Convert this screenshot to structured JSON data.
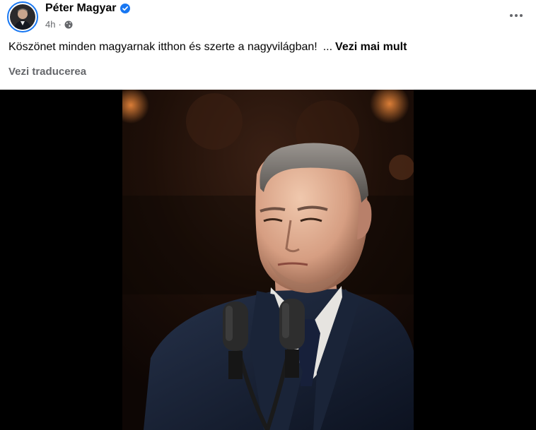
{
  "author": {
    "name": "Péter Magyar",
    "verified": true,
    "accent": "#1877f2"
  },
  "meta": {
    "time": "4h",
    "separator": "·",
    "audience_icon": "globe-icon"
  },
  "post": {
    "text": "Köszönet minden magyarnak itthon és szerte a nagyvilágban!",
    "ellipsis": "...",
    "see_more": "Vezi mai mult"
  },
  "translate_label": "Vezi traducerea",
  "more_icon": "more-options-icon",
  "photo": {
    "description_icon": "photo-man-at-microphones"
  }
}
